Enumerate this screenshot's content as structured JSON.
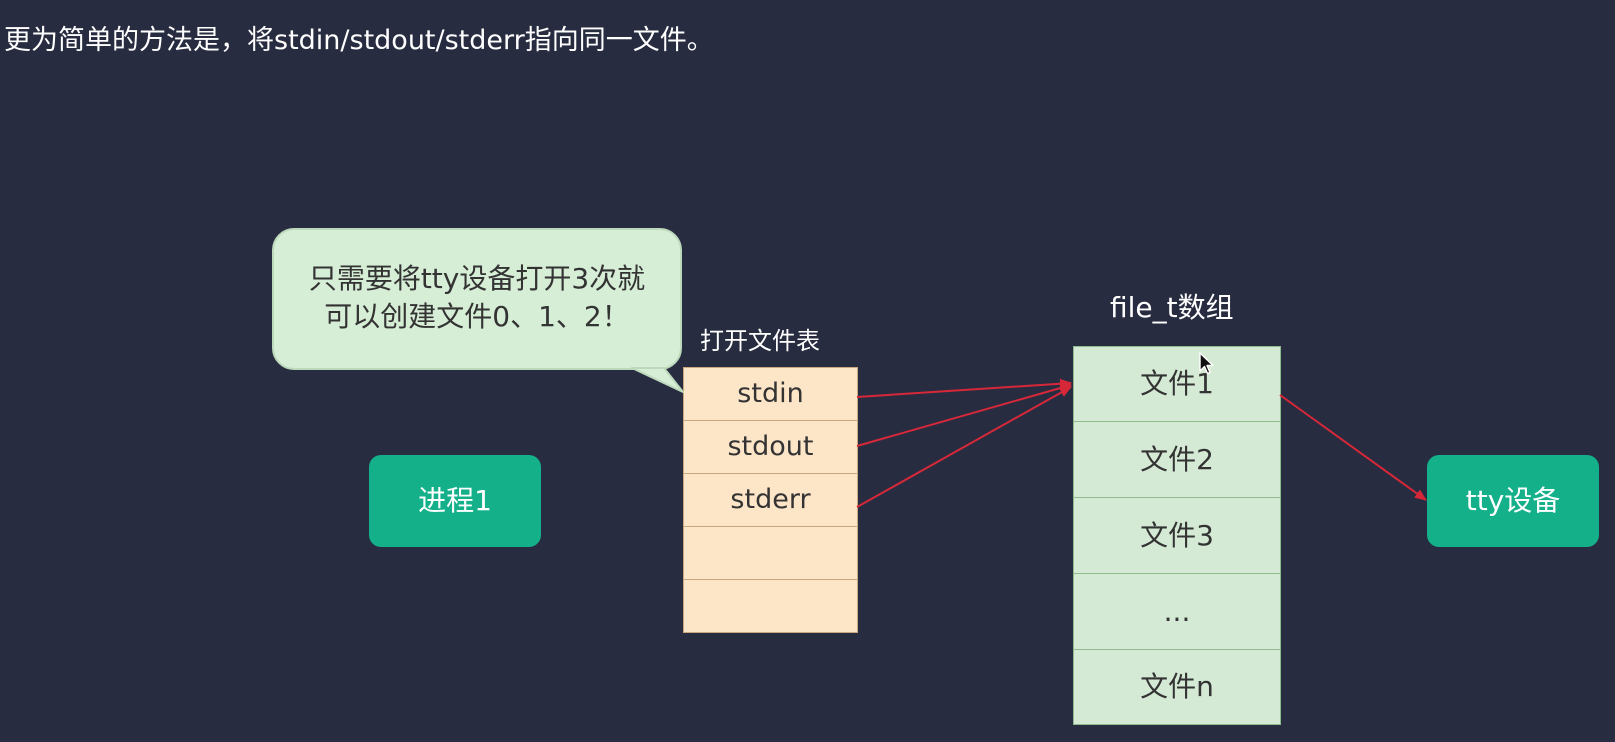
{
  "heading": "更为简单的方法是，将stdin/stdout/stderr指向同一文件。",
  "bubble": {
    "line1": "只需要将tty设备打开3次就",
    "line2": "可以创建文件0、1、2！"
  },
  "open_file_table": {
    "title": "打开文件表",
    "rows": [
      "stdin",
      "stdout",
      "stderr",
      "",
      ""
    ]
  },
  "file_array": {
    "title": "file_t数组",
    "rows": [
      "文件1",
      "文件2",
      "文件3",
      "...",
      "文件n"
    ]
  },
  "process_label": "进程1",
  "tty_label": "tty设备",
  "colors": {
    "background": "#282c40",
    "arrow": "#d62839",
    "node_green": "#13b08a",
    "bubble_fill": "#d6edd6",
    "table_fill": "#fde5c8",
    "array_fill": "#d5ead5"
  }
}
